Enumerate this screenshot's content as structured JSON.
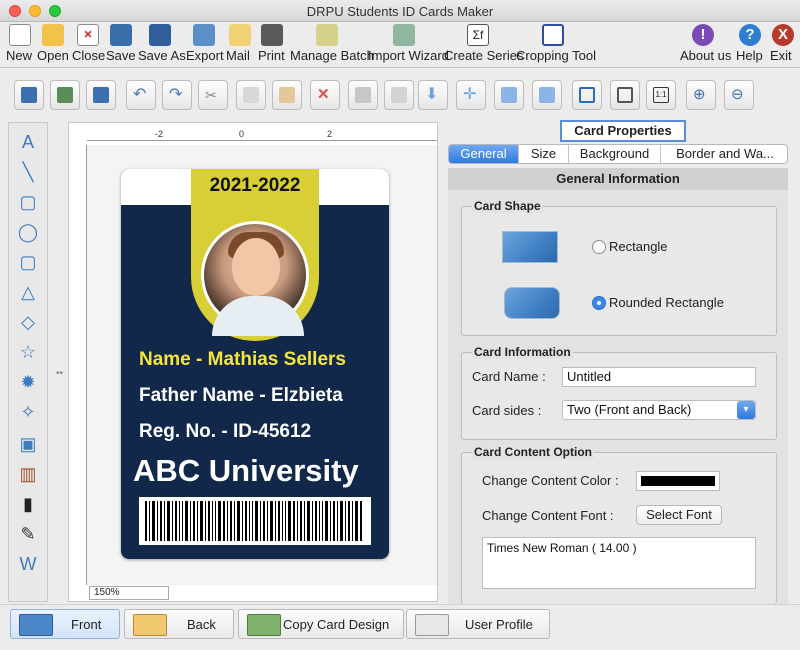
{
  "window": {
    "title": "DRPU Students ID Cards Maker"
  },
  "main_toolbar": [
    {
      "label": "New",
      "icon": "new-doc-icon"
    },
    {
      "label": "Open",
      "icon": "open-folder-icon"
    },
    {
      "label": "Close",
      "icon": "close-doc-icon"
    },
    {
      "label": "Save",
      "icon": "save-icon"
    },
    {
      "label": "Save As",
      "icon": "save-as-icon"
    },
    {
      "label": "Export",
      "icon": "export-icon"
    },
    {
      "label": "Mail",
      "icon": "mail-icon"
    },
    {
      "label": "Print",
      "icon": "print-icon"
    },
    {
      "label": "Manage Batch",
      "icon": "manage-batch-icon"
    },
    {
      "label": "Import Wizard",
      "icon": "import-wizard-icon"
    },
    {
      "label": "Create Series",
      "icon": "create-series-icon"
    },
    {
      "label": "Cropping Tool",
      "icon": "cropping-tool-icon"
    }
  ],
  "right_toolbar": [
    {
      "label": "About us",
      "icon": "about-icon",
      "glyph": "!"
    },
    {
      "label": "Help",
      "icon": "help-icon",
      "glyph": "?"
    },
    {
      "label": "Exit",
      "icon": "exit-icon",
      "glyph": "X"
    }
  ],
  "ruler": {
    "h_labels": [
      "-2",
      "0",
      "2"
    ]
  },
  "canvas": {
    "zoom": "150%"
  },
  "card": {
    "year": "2021-2022",
    "name": "Name - Mathias  Sellers",
    "father": "Father Name - Elzbieta",
    "reg": "Reg. No. - ID-45612",
    "university": "ABC University"
  },
  "panel": {
    "title": "Card Properties",
    "tabs": [
      "General",
      "Size",
      "Background",
      "Border and Wa..."
    ],
    "section_header": "General Information",
    "card_shape": {
      "title": "Card Shape",
      "options": [
        "Rectangle",
        "Rounded Rectangle"
      ],
      "selected": "Rounded Rectangle"
    },
    "card_info": {
      "title": "Card Information",
      "name_label": "Card Name :",
      "name_value": "Untitled",
      "sides_label": "Card sides :",
      "sides_value": "Two (Front and Back)"
    },
    "content_option": {
      "title": "Card Content Option",
      "color_label": "Change Content Color :",
      "color_value": "#000000",
      "font_label": "Change Content Font :",
      "font_button": "Select Font",
      "font_value": "Times New Roman ( 14.00 )"
    }
  },
  "bottom": {
    "front": "Front",
    "back": "Back",
    "copy": "Copy Card Design",
    "profile": "User Profile"
  },
  "colors": {
    "card_bg": "#12284a",
    "card_yellow": "#d7cf35",
    "name_text": "#f5e63a",
    "accent": "#2f79e0"
  }
}
